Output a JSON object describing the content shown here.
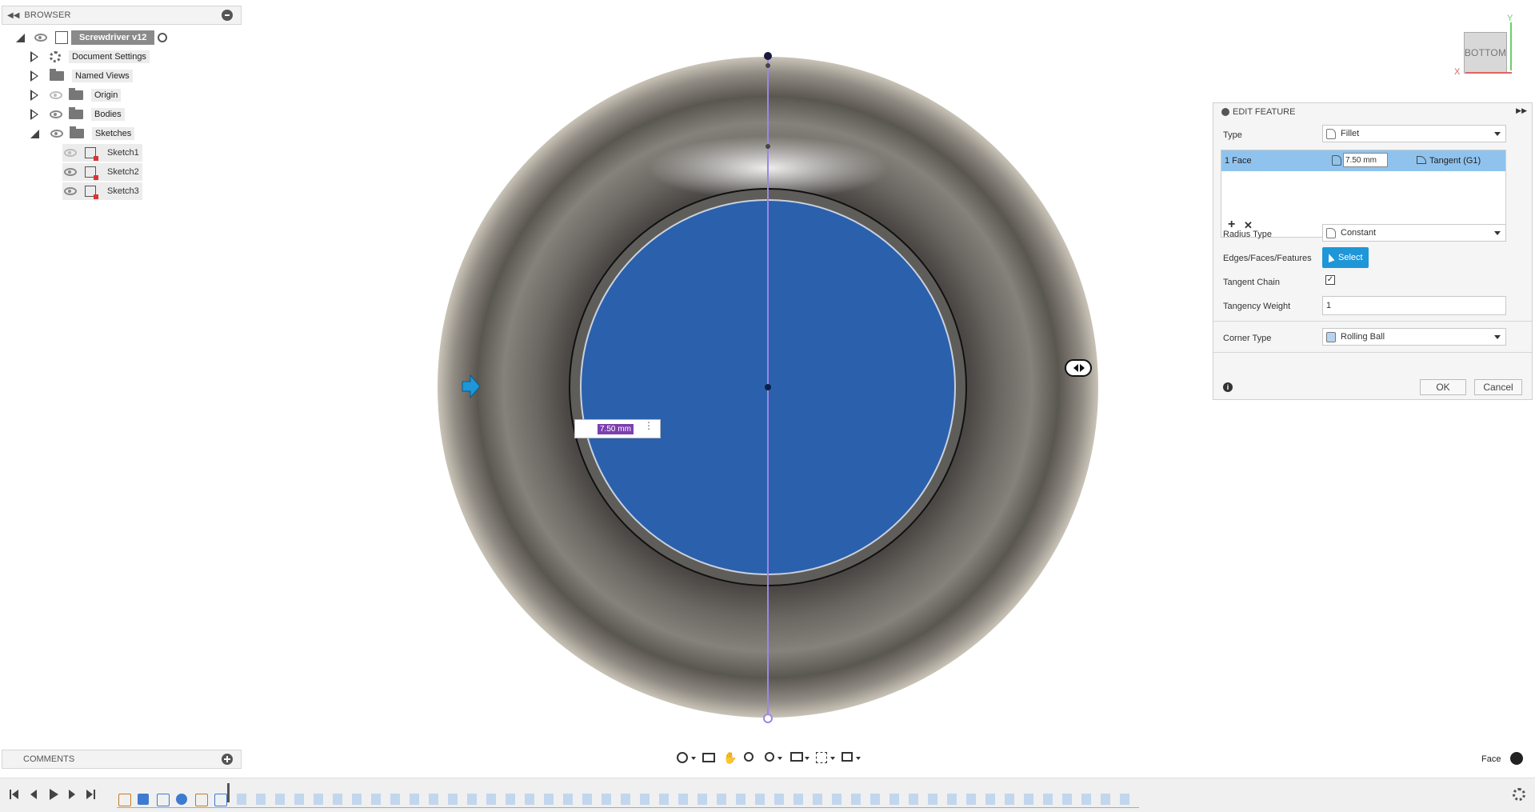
{
  "browser": {
    "title": "BROWSER",
    "root": {
      "label": "Screwdriver v12"
    },
    "items": [
      {
        "label": "Document Settings"
      },
      {
        "label": "Named Views"
      },
      {
        "label": "Origin"
      },
      {
        "label": "Bodies"
      },
      {
        "label": "Sketches"
      }
    ],
    "sketches": [
      {
        "label": "Sketch1"
      },
      {
        "label": "Sketch2"
      },
      {
        "label": "Sketch3"
      }
    ]
  },
  "viewcube": {
    "face": "BOTTOM",
    "axis_x": "X",
    "axis_y": "Y"
  },
  "edit_feature": {
    "title": "EDIT FEATURE",
    "type_label": "Type",
    "type_value": "Fillet",
    "selection_row": {
      "label": "1 Face",
      "radius": "7.50 mm",
      "continuity": "Tangent (G1)"
    },
    "radius_type_label": "Radius Type",
    "radius_type_value": "Constant",
    "edges_label": "Edges/Faces/Features",
    "select_button": "Select",
    "tangent_chain_label": "Tangent Chain",
    "tangent_chain_checked": true,
    "tangency_weight_label": "Tangency Weight",
    "tangency_weight_value": "1",
    "corner_type_label": "Corner Type",
    "corner_type_value": "Rolling Ball",
    "ok_button": "OK",
    "cancel_button": "Cancel"
  },
  "canvas": {
    "dimension_input": "7.50 mm",
    "colors": {
      "face_selected": "#2b60ad",
      "body": "#6e6a63",
      "sketch_line": "#9b87e6",
      "accent": "#1e96d8"
    }
  },
  "comments": {
    "title": "COMMENTS"
  },
  "status": {
    "selection": "Face"
  },
  "nav_tools": [
    "orbit-icon",
    "look-at-icon",
    "pan-icon",
    "zoom-icon",
    "fit-icon",
    "display-settings-icon",
    "grid-icon",
    "viewports-icon"
  ]
}
